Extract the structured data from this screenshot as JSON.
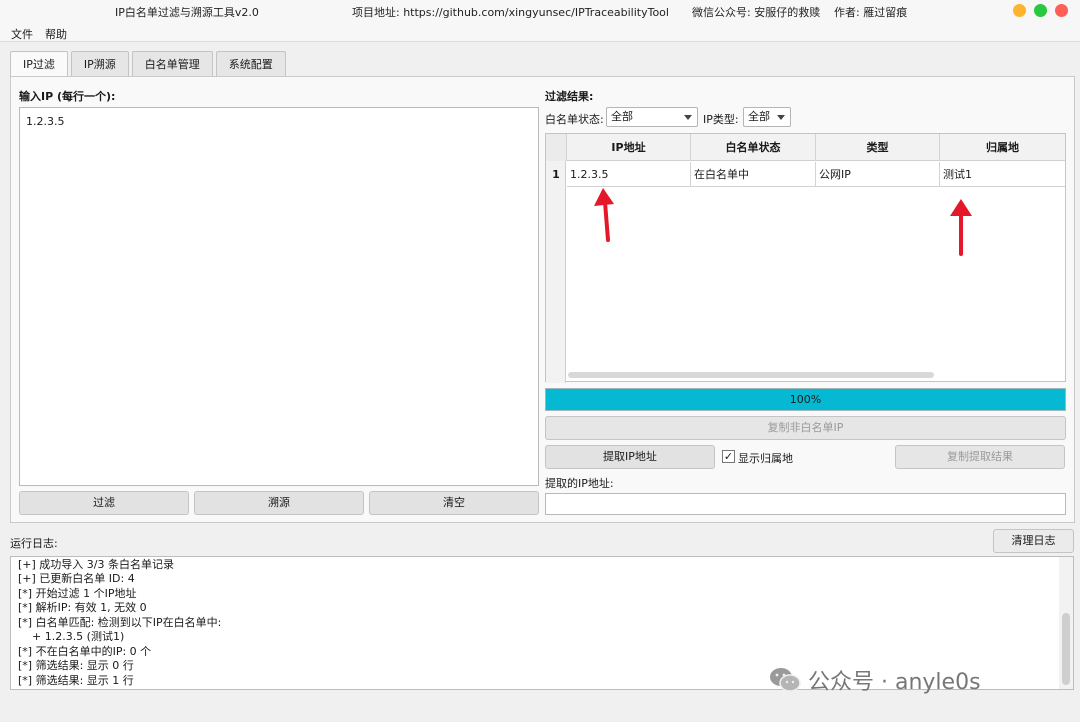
{
  "window": {
    "title": "IP白名单过滤与溯源工具v2.0",
    "project_label": "项目地址: https://github.com/xingyunsec/IPTraceabilityTool",
    "wechat_label": "微信公众号: 安服仔的救赎",
    "author_label": "作者: 雁过留痕"
  },
  "menu": [
    "文件",
    "帮助"
  ],
  "tabs": [
    "IP过滤",
    "IP溯源",
    "白名单管理",
    "系统配置"
  ],
  "input": {
    "label": "输入IP (每行一个):",
    "value": "1.2.3.5"
  },
  "left_buttons": {
    "filter": "过滤",
    "trace": "溯源",
    "clear": "清空"
  },
  "results": {
    "label": "过滤结果:",
    "whitelist_status_label": "白名单状态:",
    "whitelist_status_value": "全部",
    "ip_type_label": "IP类型:",
    "ip_type_value": "全部",
    "columns": [
      "IP地址",
      "白名单状态",
      "类型",
      "归属地"
    ],
    "rows": [
      {
        "num": "1",
        "cells": [
          "1.2.3.5",
          "在白名单中",
          "公网IP",
          "测试1"
        ]
      }
    ]
  },
  "progress": {
    "text": "100%",
    "value": 1.0
  },
  "actions": {
    "copy_non_whitelist": "复制非白名单IP",
    "extract_ip": "提取IP地址",
    "show_location": "显示归属地",
    "show_location_checked": true,
    "copy_extract": "复制提取结果",
    "extracted_label": "提取的IP地址:",
    "extracted_value": ""
  },
  "log": {
    "label": "运行日志:",
    "clear_button": "清理日志",
    "lines": [
      "[+] 成功导入 3/3 条白名单记录",
      "[+] 已更新白名单 ID: 4",
      "[*] 开始过滤 1 个IP地址",
      "[*] 解析IP: 有效 1, 无效 0",
      "[*] 白名单匹配: 检测到以下IP在白名单中:",
      "    + 1.2.3.5 (测试1)",
      "[*] 不在白名单中的IP: 0 个",
      "[*] 筛选结果: 显示 0 行",
      "[*] 筛选结果: 显示 1 行"
    ]
  },
  "watermark": "公众号 · anyle0s",
  "colors": {
    "progress": "#06b9d2",
    "arrow": "#e5182a",
    "dot_close": "#ff5f57",
    "dot_min": "#febc2e",
    "dot_max": "#28c840"
  }
}
